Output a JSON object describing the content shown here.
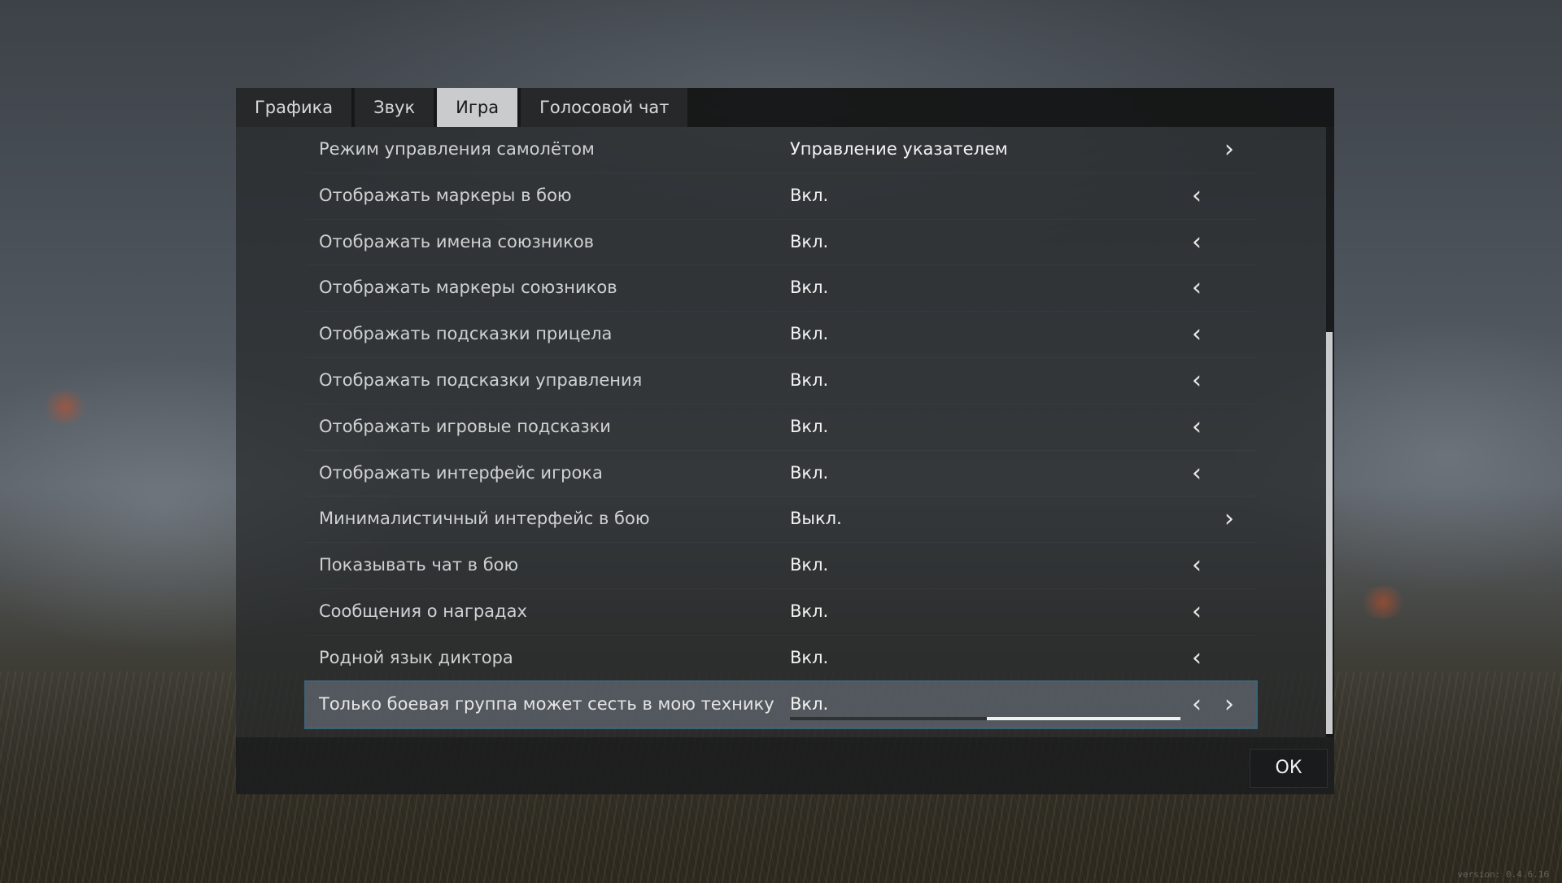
{
  "tabs": [
    {
      "label": "Графика",
      "active": false
    },
    {
      "label": "Звук",
      "active": false
    },
    {
      "label": "Игра",
      "active": true
    },
    {
      "label": "Голосовой чат",
      "active": false
    }
  ],
  "settings": [
    {
      "label": "Режим управления самолётом",
      "value": "Управление указателем",
      "left": false,
      "right": true
    },
    {
      "label": "Отображать маркеры в бою",
      "value": "Вкл.",
      "left": true,
      "right": false
    },
    {
      "label": "Отображать имена союзников",
      "value": "Вкл.",
      "left": true,
      "right": false
    },
    {
      "label": "Отображать маркеры союзников",
      "value": "Вкл.",
      "left": true,
      "right": false
    },
    {
      "label": "Отображать подсказки прицела",
      "value": "Вкл.",
      "left": true,
      "right": false
    },
    {
      "label": "Отображать подсказки управления",
      "value": "Вкл.",
      "left": true,
      "right": false
    },
    {
      "label": "Отображать игровые подсказки",
      "value": "Вкл.",
      "left": true,
      "right": false
    },
    {
      "label": "Отображать интерфейс игрока",
      "value": "Вкл.",
      "left": true,
      "right": false
    },
    {
      "label": "Минималистичный интерфейс в бою",
      "value": "Выкл.",
      "left": false,
      "right": true
    },
    {
      "label": "Показывать чат в бою",
      "value": "Вкл.",
      "left": true,
      "right": false
    },
    {
      "label": "Сообщения о наградах",
      "value": "Вкл.",
      "left": true,
      "right": false
    },
    {
      "label": "Родной язык диктора",
      "value": "Вкл.",
      "left": true,
      "right": false
    },
    {
      "label": "Только боевая группа может сесть в мою технику",
      "value": "Вкл.",
      "left": true,
      "right": true,
      "selected": true
    }
  ],
  "footer": {
    "ok_label": "ОК"
  },
  "version": "version: 0.4.6.16",
  "icons": {
    "left": "‹",
    "right": "›"
  },
  "colors": {
    "active_tab": "#c9cbcc",
    "selected_row": "#5a6068"
  }
}
